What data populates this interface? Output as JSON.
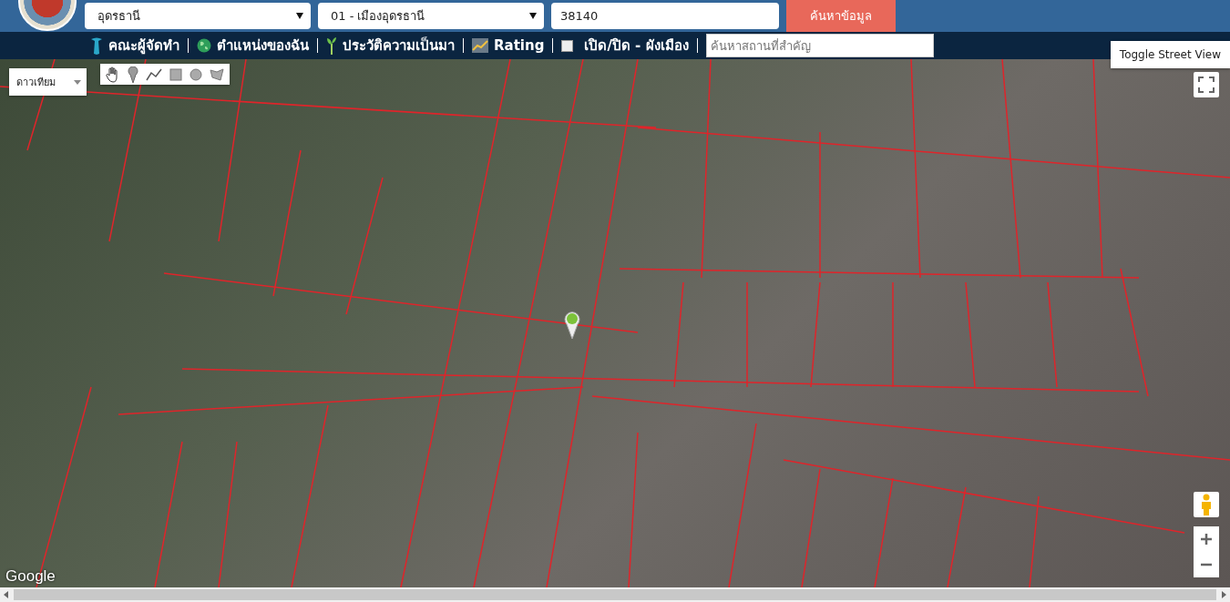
{
  "header": {
    "province_select": {
      "value": "อุดรธานี"
    },
    "district_select": {
      "value": "01 - เมืองอุดรธานี"
    },
    "postcode_input": {
      "value": "38140"
    },
    "search_button": {
      "label": "ค้นหาข้อมูล"
    }
  },
  "nav": {
    "items": [
      {
        "kind": "link",
        "label": "คณะผู้จัดทำ"
      },
      {
        "kind": "link",
        "label": "ตำแหน่งของฉัน"
      },
      {
        "kind": "link",
        "label": "ประวัติความเป็นมา"
      },
      {
        "kind": "link",
        "label": "Rating"
      },
      {
        "kind": "checkbox",
        "label": "เปิด/ปิด - ผังเมือง",
        "checked": false
      }
    ],
    "place_search": {
      "placeholder": "ค้นหาสถานที่สำคัญ"
    }
  },
  "map": {
    "type_select": {
      "value": "ดาวเทียม"
    },
    "street_view_button": {
      "label": "Toggle Street View"
    },
    "attribution": "Google"
  }
}
